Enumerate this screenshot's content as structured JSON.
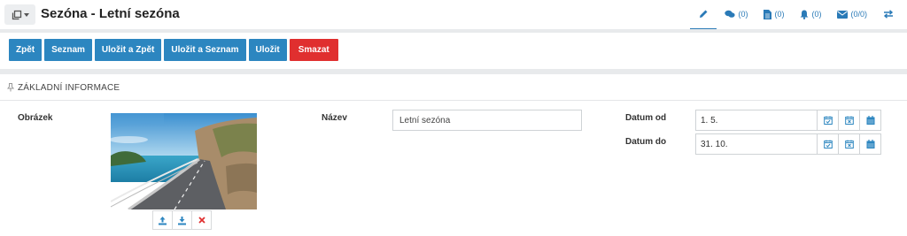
{
  "header": {
    "title": "Sezóna - Letní sezóna",
    "tabs": [
      {
        "icon": "pencil-icon",
        "count": ""
      },
      {
        "icon": "comments-icon",
        "count": "(0)"
      },
      {
        "icon": "document-icon",
        "count": "(0)"
      },
      {
        "icon": "bell-icon",
        "count": "(0)"
      },
      {
        "icon": "envelope-icon",
        "count": "(0/0)"
      },
      {
        "icon": "swap-icon",
        "count": ""
      }
    ]
  },
  "toolbar": {
    "back": "Zpět",
    "list": "Seznam",
    "save_back": "Uložit a Zpět",
    "save_list": "Uložit a Seznam",
    "save": "Uložit",
    "delete": "Smazat"
  },
  "section": {
    "title": "ZÁKLADNÍ INFORMACE"
  },
  "form": {
    "image_label": "Obrázek",
    "name_label": "Název",
    "name_value": "Letní sezóna",
    "date_from_label": "Datum od",
    "date_from_value": "1. 5.",
    "date_to_label": "Datum do",
    "date_to_value": "31. 10."
  },
  "colors": {
    "accent": "#2c86c0",
    "danger": "#e02f2f",
    "link": "#2a7ab7"
  }
}
